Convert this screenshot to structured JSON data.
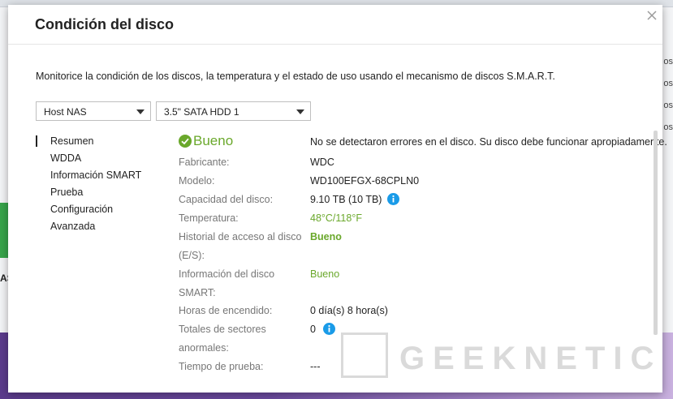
{
  "background": {
    "left_text": "AS",
    "right_texts": [
      "os",
      "os",
      "os",
      "os"
    ]
  },
  "modal": {
    "title": "Condición del disco",
    "description": "Monitorice la condición de los discos, la temperatura y el estado de uso usando el mecanismo de discos S.M.A.R.T.",
    "host_select": "Host NAS",
    "disk_select": "3.5\" SATA HDD 1",
    "sidebar": {
      "items": [
        {
          "label": "Resumen",
          "active": true
        },
        {
          "label": "WDDA",
          "active": false
        },
        {
          "label": "Información SMART",
          "active": false
        },
        {
          "label": "Prueba",
          "active": false
        },
        {
          "label": "Configuración",
          "active": false
        },
        {
          "label": "Avanzada",
          "active": false
        }
      ]
    },
    "summary": {
      "status": "Bueno",
      "status_message": "No se detectaron errores en el disco. Su disco debe funcionar apropiadamente.",
      "rows": {
        "manufacturer": {
          "label": "Fabricante:",
          "value": "WDC"
        },
        "model": {
          "label": "Modelo:",
          "value": "WD100EFGX-68CPLN0"
        },
        "capacity": {
          "label": "Capacidad del disco:",
          "value": "9.10 TB (10 TB)"
        },
        "temperature": {
          "label": "Temperatura:",
          "value": "48°C/118°F"
        },
        "io_history": {
          "label_line1": "Historial de acceso al disco",
          "label_line2": "(E/S):",
          "value": "Bueno"
        },
        "smart_info": {
          "label_line1": "Información del disco",
          "label_line2": "SMART:",
          "value": "Bueno"
        },
        "power_on_hours": {
          "label": "Horas de encendido:",
          "value": "0 día(s) 8 hora(s)"
        },
        "abnormal_sectors": {
          "label_line1": "Totales de sectores",
          "label_line2": "anormales:",
          "value": "0"
        },
        "test_time": {
          "label": "Tiempo de prueba:",
          "value": "---"
        }
      }
    }
  },
  "watermark": {
    "text": "GEEKNETIC"
  },
  "colors": {
    "good": "#6aa82b",
    "info": "#1a9be8"
  }
}
